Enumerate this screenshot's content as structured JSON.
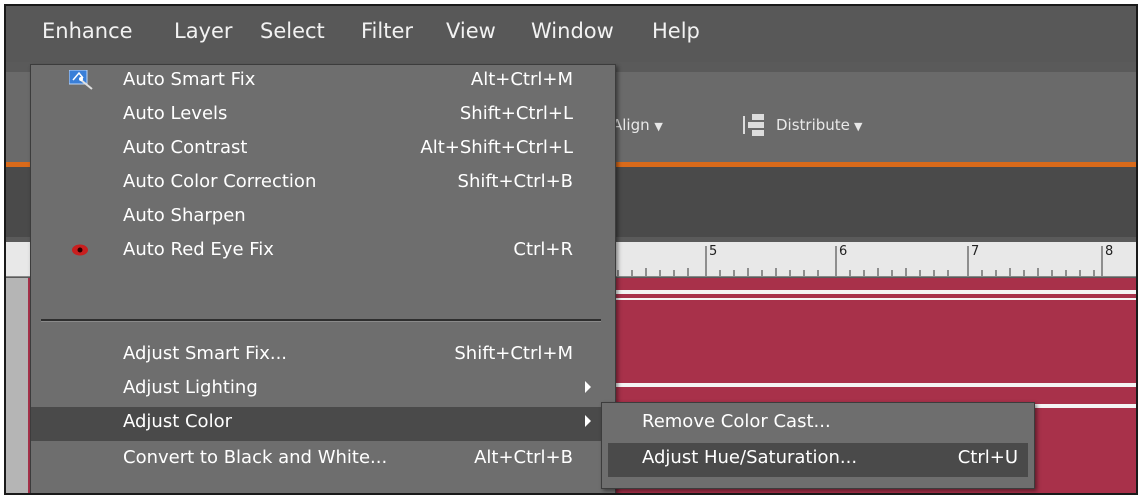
{
  "menubar": {
    "items": [
      {
        "label": "Enhance"
      },
      {
        "label": "Layer"
      },
      {
        "label": "Select"
      },
      {
        "label": "Filter"
      },
      {
        "label": "View"
      },
      {
        "label": "Window"
      },
      {
        "label": "Help"
      }
    ]
  },
  "toolbar": {
    "align_label": "Align",
    "distribute_label": "Distribute"
  },
  "ruler": {
    "numbers": [
      "5",
      "6",
      "7",
      "8"
    ]
  },
  "enhance_menu": {
    "items": [
      {
        "label": "Auto Smart Fix",
        "shortcut": "Alt+Ctrl+M",
        "icon": "auto-smart-fix-icon"
      },
      {
        "label": "Auto Levels",
        "shortcut": "Shift+Ctrl+L"
      },
      {
        "label": "Auto Contrast",
        "shortcut": "Alt+Shift+Ctrl+L"
      },
      {
        "label": "Auto Color Correction",
        "shortcut": "Shift+Ctrl+B"
      },
      {
        "label": "Auto Sharpen",
        "shortcut": ""
      },
      {
        "label": "Auto Red Eye Fix",
        "shortcut": "Ctrl+R",
        "icon": "red-eye-icon"
      },
      {
        "label": "Adjust Smart Fix...",
        "shortcut": "Shift+Ctrl+M"
      },
      {
        "label": "Adjust Lighting",
        "shortcut": "",
        "submenu": true
      },
      {
        "label": "Adjust Color",
        "shortcut": "",
        "submenu": true,
        "highlighted": true
      },
      {
        "label": "Convert to Black and White...",
        "shortcut": "Alt+Ctrl+B"
      }
    ]
  },
  "adjust_color_submenu": {
    "items": [
      {
        "label": "Remove Color Cast...",
        "shortcut": ""
      },
      {
        "label": "Adjust Hue/Saturation...",
        "shortcut": "Ctrl+U",
        "highlighted": true
      }
    ]
  },
  "colors": {
    "menu_bg": "#6e6e6e",
    "highlight": "#4a4a4a",
    "accent_orange": "#d96a1a",
    "canvas_red": "#a8314a"
  }
}
